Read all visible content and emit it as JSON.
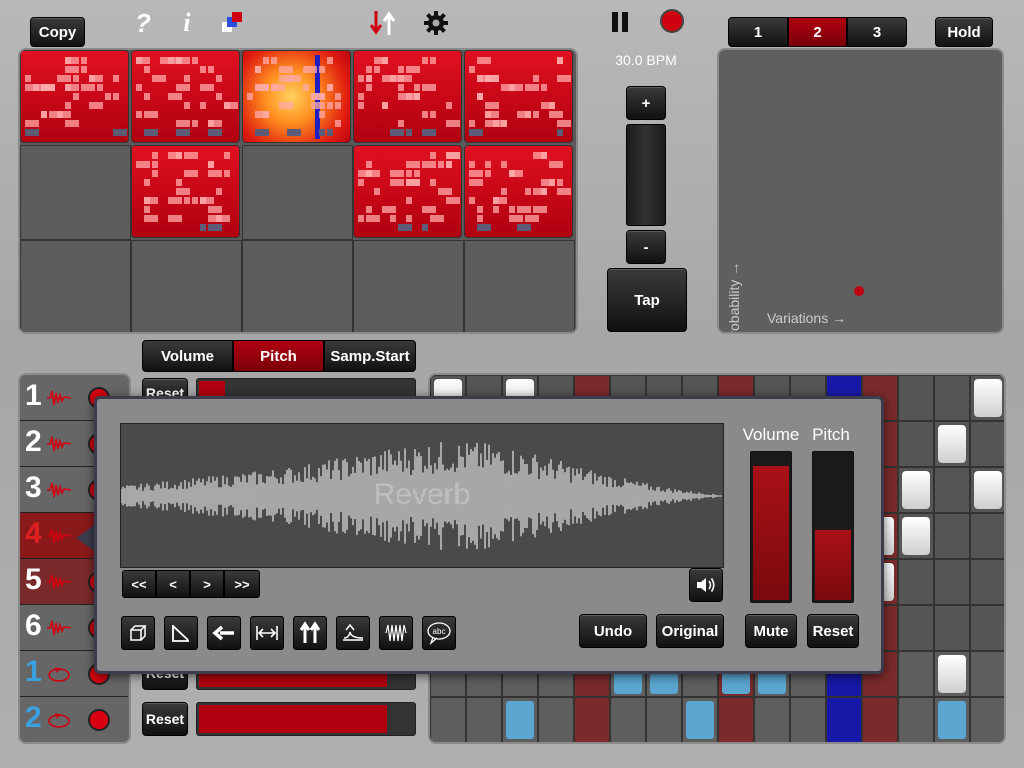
{
  "toolbar": {
    "copy_label": "Copy",
    "help_icon": "?",
    "info_icon": "i",
    "bpm": "30.0 BPM",
    "hold_label": "Hold",
    "scenes": [
      "1",
      "2",
      "3"
    ],
    "selected_scene": "2"
  },
  "tempo": {
    "plus_label": "+",
    "minus_label": "-",
    "tap_label": "Tap"
  },
  "xy_pad": {
    "y_label": "Probability →",
    "x_label": "Variations →"
  },
  "param_tabs": [
    "Volume",
    "Pitch",
    "Samp.Start"
  ],
  "selected_param_tab": "Pitch",
  "tracks": {
    "numbers": [
      "1",
      "2",
      "3",
      "4",
      "5",
      "6",
      "1",
      "2"
    ],
    "reset_label": "Reset"
  },
  "editor": {
    "sample_name": "Reverb",
    "nav": [
      "<<",
      "<",
      ">",
      ">>"
    ],
    "volume_label": "Volume",
    "pitch_label": "Pitch",
    "undo_label": "Undo",
    "original_label": "Original",
    "mute_label": "Mute",
    "reset_label": "Reset",
    "volume_level": 0.92,
    "pitch_level": 0.48,
    "tools": [
      "cube-icon",
      "fade-icon",
      "reverse-icon",
      "stretch-icon",
      "double-arrow-icon",
      "envelope-icon",
      "waveform-icon",
      "abc-speech-icon"
    ]
  },
  "colors": {
    "accent": "#c4000e",
    "blue_step": "#5aa6d0",
    "highlight_col": "#1010b0"
  }
}
